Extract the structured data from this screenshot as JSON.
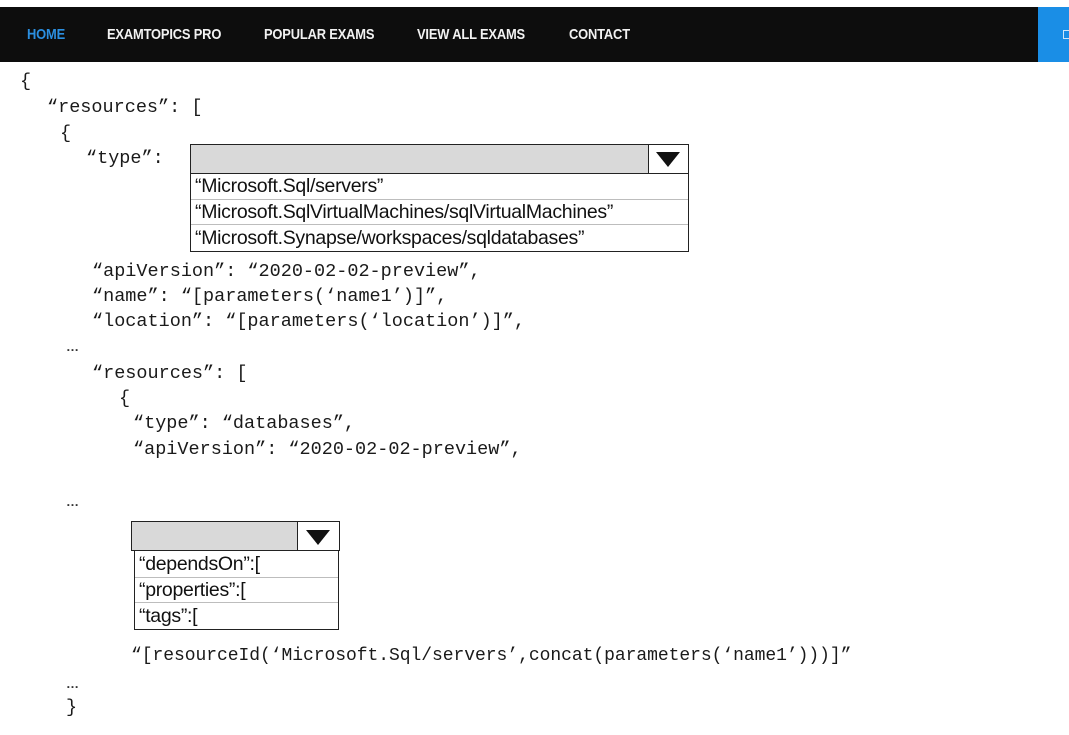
{
  "nav": {
    "items": [
      "HOME",
      "EXAMTOPICS PRO",
      "POPULAR EXAMS",
      "VIEW ALL EXAMS",
      "CONTACT"
    ],
    "active_color": "#2b8fe0",
    "bg_color": "#0d0d0d",
    "cta_color": "#1a8ee6"
  },
  "code": {
    "open_brace": "{",
    "resources_open": "“resources”: [",
    "inner_brace": "{",
    "type_key": "“type”:",
    "api_version": "“apiVersion”: “2020-02-02-preview”,",
    "name": "“name”: “[parameters(‘name1’)]”,",
    "location": "“location”: “[parameters(‘location’)]”,",
    "ellipsis": "…",
    "resources_open_2": "“resources”: [",
    "inner_brace_2": "{",
    "db_type": "“type”: “databases”,",
    "db_api_version": "“apiVersion”: “2020-02-02-preview”,",
    "resource_id": "“[resourceId(‘Microsoft.Sql/servers’,concat(parameters(‘name1’)))]”",
    "close_brace": "}"
  },
  "dropdown1": {
    "selected": "",
    "options": [
      "“Microsoft.Sql/servers”",
      "“Microsoft.SqlVirtualMachines/sqlVirtualMachines”",
      "“Microsoft.Synapse/workspaces/sqldatabases”"
    ]
  },
  "dropdown2": {
    "selected": "",
    "options": [
      "“dependsOn”:[",
      "“properties”:[",
      "“tags”:["
    ]
  }
}
